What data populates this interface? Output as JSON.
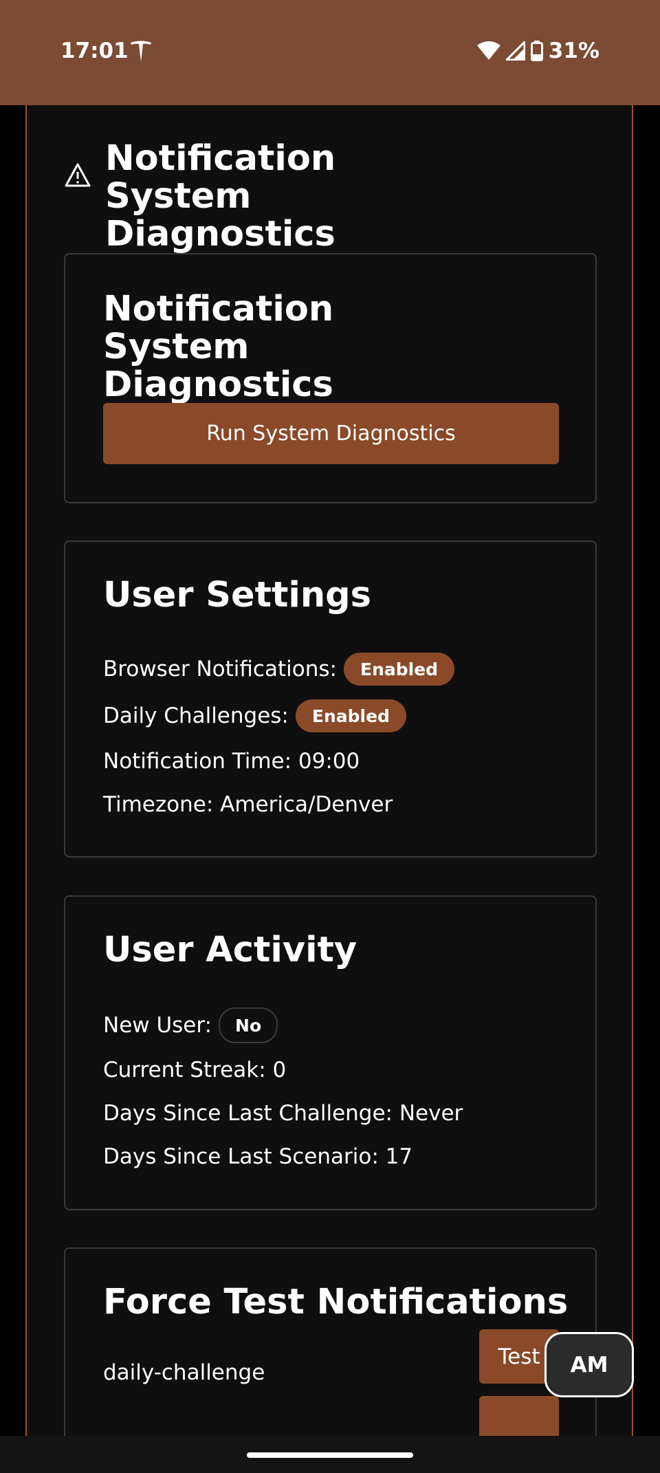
{
  "status_bar": {
    "time": "17:01",
    "battery": "31%"
  },
  "page": {
    "title": "Notification System Diagnostics"
  },
  "diagnostics_card": {
    "title": "Notification System Diagnostics",
    "run_button": "Run System Diagnostics"
  },
  "user_settings": {
    "title": "User Settings",
    "browser_notifications_label": "Browser Notifications:",
    "browser_notifications_value": "Enabled",
    "daily_challenges_label": "Daily Challenges:",
    "daily_challenges_value": "Enabled",
    "notification_time": "Notification Time: 09:00",
    "timezone": "Timezone: America/Denver"
  },
  "user_activity": {
    "title": "User Activity",
    "new_user_label": "New User:",
    "new_user_value": "No",
    "current_streak": "Current Streak: 0",
    "days_since_challenge": "Days Since Last Challenge: Never",
    "days_since_scenario": "Days Since Last Scenario: 17"
  },
  "force_test": {
    "title": "Force Test Notifications",
    "items": [
      {
        "name": "daily-challenge",
        "button": "Test"
      }
    ]
  },
  "floating_button": {
    "label": "AM"
  },
  "colors": {
    "accent": "#8a4a29",
    "status_bar": "#7b4b33",
    "panel_bg": "#0f0f0f"
  }
}
